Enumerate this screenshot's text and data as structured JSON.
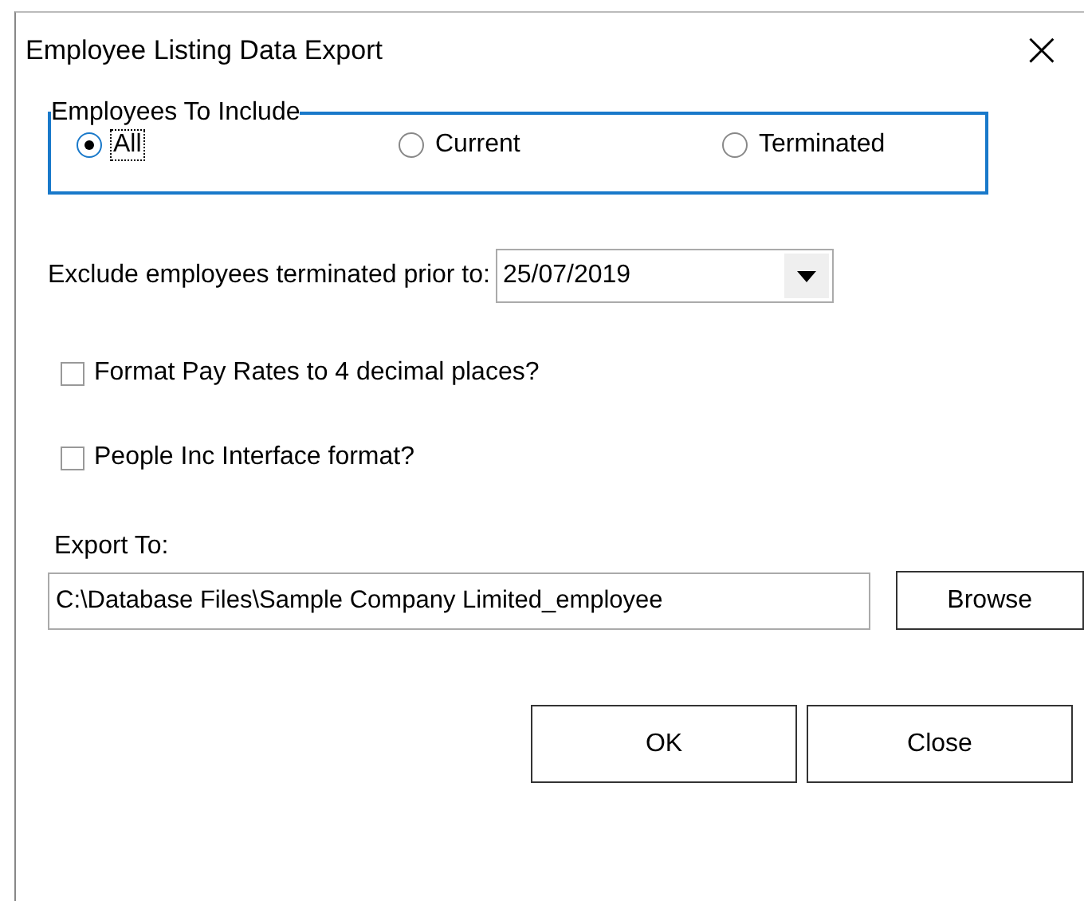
{
  "window": {
    "title": "Employee Listing Data Export",
    "close": "×"
  },
  "group": {
    "title": "Employees To Include",
    "options": [
      {
        "label": "All",
        "selected": true,
        "focused": true
      },
      {
        "label": "Current",
        "selected": false,
        "focused": false
      },
      {
        "label": "Terminated",
        "selected": false,
        "focused": false
      }
    ]
  },
  "exclude": {
    "label": "Exclude employees terminated prior to:",
    "value": "25/07/2019"
  },
  "checkboxes": [
    {
      "label": "Format Pay Rates to 4 decimal places?",
      "checked": false
    },
    {
      "label": "People Inc Interface format?",
      "checked": false
    }
  ],
  "export": {
    "label": "Export To:",
    "value": "C:\\Database Files\\Sample Company Limited_employee",
    "browse": "Browse"
  },
  "buttons": [
    "OK",
    "Close"
  ]
}
